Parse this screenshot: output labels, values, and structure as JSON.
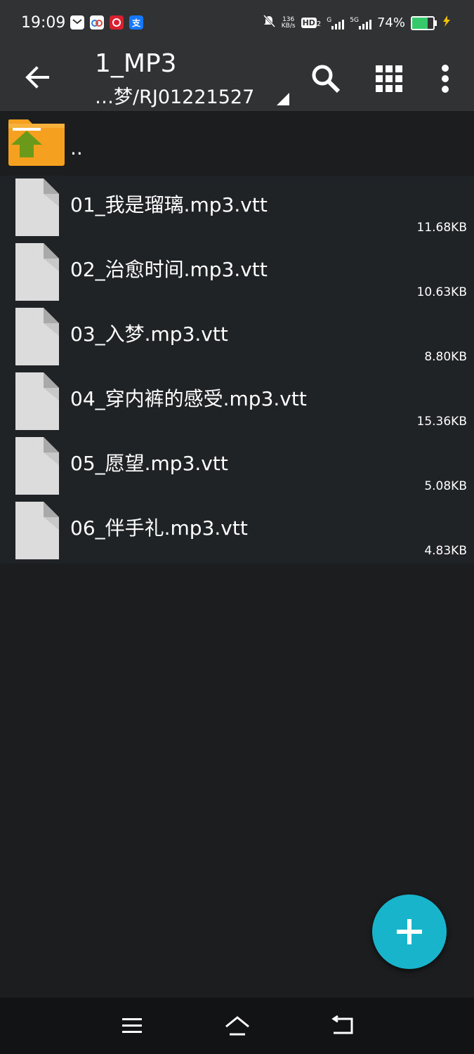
{
  "status": {
    "time": "19:09",
    "speed_value": "136",
    "speed_unit": "KB/s",
    "hd": "HD",
    "hd_sub": "2",
    "net1": "G",
    "net2": "5G",
    "battery": "74%",
    "battery_level": 0.74,
    "app_icons": [
      "message-icon",
      "cloud-app-icon",
      "bank-app-icon",
      "alipay-icon"
    ],
    "alipay_glyph": "支"
  },
  "toolbar": {
    "title": "1_MP3",
    "path": "…梦/RJ01221527"
  },
  "parent": {
    "label": ".."
  },
  "files": [
    {
      "name": "01_我是瑠璃.mp3.vtt",
      "size": "11.68KB"
    },
    {
      "name": "02_治愈时间.mp3.vtt",
      "size": "10.63KB"
    },
    {
      "name": "03_入梦.mp3.vtt",
      "size": "8.80KB"
    },
    {
      "name": "04_穿内裤的感受.mp3.vtt",
      "size": "15.36KB"
    },
    {
      "name": "05_愿望.mp3.vtt",
      "size": "5.08KB"
    },
    {
      "name": "06_伴手礼.mp3.vtt",
      "size": "4.83KB"
    }
  ],
  "colors": {
    "background": "#1b1d1f",
    "toolbar": "#303234",
    "row": "#202325",
    "fab": "#17b4cb",
    "folder": "#f5a01e",
    "folder_arrow": "#6b9a1a",
    "battery_fill": "#35c96a"
  }
}
